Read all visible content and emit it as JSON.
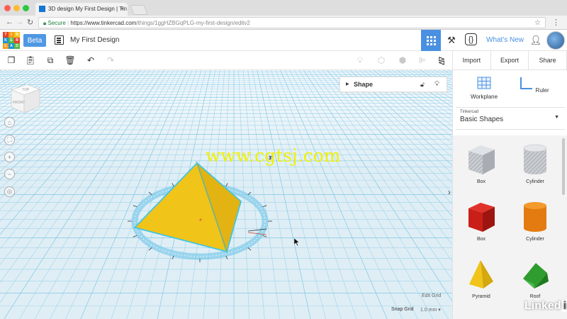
{
  "browser": {
    "tab_title": "3D design My First Design | Tin",
    "secure_label": "Secure",
    "url_host": "https://www.tinkercad.com",
    "url_path": "/things/1ggHZBGqPLG-my-first-design/editv2"
  },
  "header": {
    "logo_letters": [
      "TIN",
      "KER",
      "CAD"
    ],
    "beta_label": "Beta",
    "design_title": "My First Design",
    "whats_new": "What's New"
  },
  "side_actions": {
    "import": "Import",
    "export": "Export",
    "share": "Share"
  },
  "shape_panel": {
    "label": "Shape"
  },
  "viewcube": {
    "top": "TOP",
    "front": "FRONT"
  },
  "workplane": {
    "angle_readout": "3°",
    "watermark": "www.cgtsj.com",
    "edit_grid": "Edit Grid",
    "snap_grid_label": "Snap Grid",
    "snap_grid_value": "1.0 mm"
  },
  "right_panel": {
    "workplane_label": "Workplane",
    "ruler_label": "Ruler",
    "library_source": "Tinkercad",
    "library_name": "Basic Shapes",
    "shapes": [
      "Box",
      "Cylinder",
      "Box",
      "Cylinder",
      "Pyramid",
      "Roof"
    ]
  },
  "branding": {
    "linkedin_a": "Linked",
    "linkedin_b": "in"
  },
  "colors": {
    "accent": "#4a90e2",
    "pyramid_yellow": "#f0c419",
    "selection_cyan": "#41c6e2"
  }
}
